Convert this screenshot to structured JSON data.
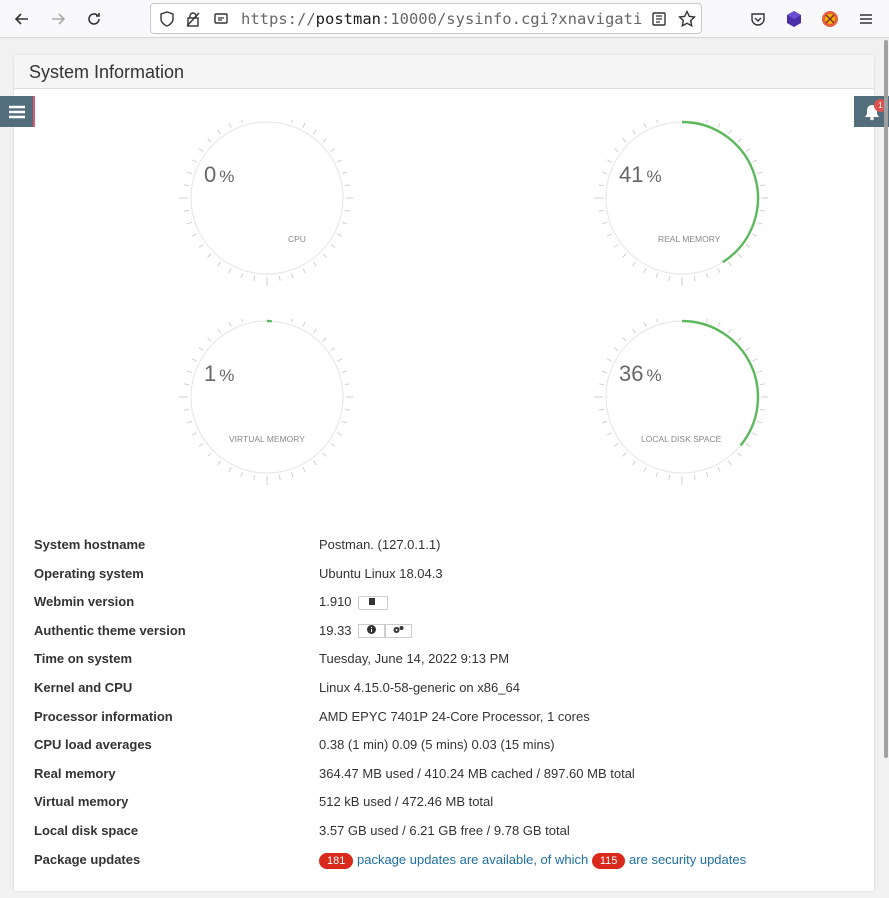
{
  "browser": {
    "url_prefix": "https://",
    "url_host": "postman",
    "url_rest": ":10000/sysinfo.cgi?xnavigati"
  },
  "page": {
    "title": "System Information"
  },
  "notifications": {
    "count": "1"
  },
  "gauges": [
    {
      "value": "0",
      "unit": "%",
      "label": "CPU",
      "fraction": 0.0
    },
    {
      "value": "41",
      "unit": "%",
      "label": "REAL MEMORY",
      "fraction": 0.41
    },
    {
      "value": "1",
      "unit": "%",
      "label": "VIRTUAL MEMORY",
      "fraction": 0.01
    },
    {
      "value": "36",
      "unit": "%",
      "label": "LOCAL DISK SPACE",
      "fraction": 0.36
    }
  ],
  "info": {
    "rows": [
      {
        "key": "System hostname",
        "value": "Postman. (127.0.1.1)"
      },
      {
        "key": "Operating system",
        "value": "Ubuntu Linux 18.04.3"
      },
      {
        "key": "Webmin version",
        "value": "1.910"
      },
      {
        "key": "Authentic theme version",
        "value": "19.33"
      },
      {
        "key": "Time on system",
        "value": "Tuesday, June 14, 2022 9:13 PM"
      },
      {
        "key": "Kernel and CPU",
        "value": "Linux 4.15.0-58-generic on x86_64"
      },
      {
        "key": "Processor information",
        "value": "AMD EPYC 7401P 24-Core Processor, 1 cores"
      },
      {
        "key": "CPU load averages",
        "value": "0.38 (1 min) 0.09 (5 mins) 0.03 (15 mins)"
      },
      {
        "key": "Real memory",
        "value": "364.47 MB used / 410.24 MB cached / 897.60 MB total"
      },
      {
        "key": "Virtual memory",
        "value": "512 kB used / 472.46 MB total"
      },
      {
        "key": "Local disk space",
        "value": "3.57 GB used / 6.21 GB free / 9.78 GB total"
      },
      {
        "key": "Package updates",
        "value": ""
      }
    ],
    "packages": {
      "count": "181",
      "text1": "package updates are available, of which",
      "security_count": "115",
      "text2": "are security updates"
    }
  },
  "colors": {
    "gauge_fill": "#5cb85c",
    "gauge_track": "#e8e8e8",
    "badge": "#d9291c",
    "sidebar": "#526d7c"
  }
}
